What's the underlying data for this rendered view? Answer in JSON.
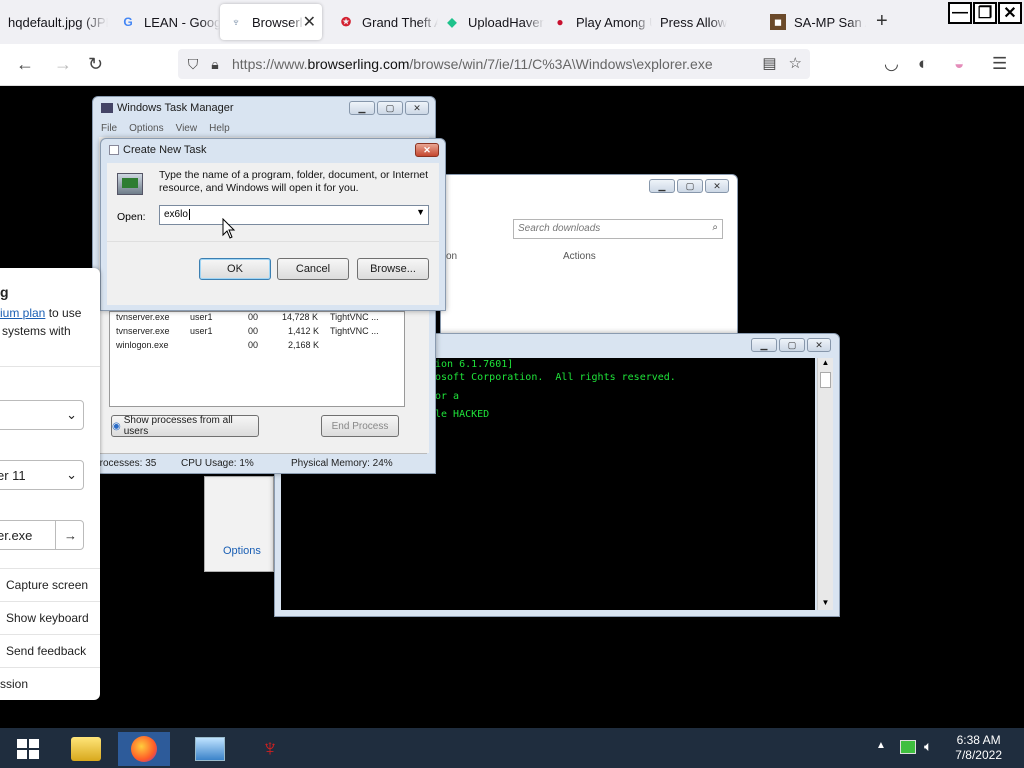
{
  "browser": {
    "tabs": [
      {
        "label": "hqdefault.jpg (JPEG",
        "icon": "image-icon"
      },
      {
        "label": "LEAN - Google",
        "icon": "google-icon"
      },
      {
        "label": "Browserling",
        "icon": "browserling-icon",
        "active": true
      },
      {
        "label": "Grand Theft Auto",
        "icon": "rockstar-icon"
      },
      {
        "label": "UploadHaven",
        "icon": "uploadhaven-icon"
      },
      {
        "label": "Play Among Us",
        "icon": "amongus-icon"
      },
      {
        "label": "Press Allow",
        "icon": ""
      },
      {
        "label": "SA-MP San Andreas",
        "icon": "samp-icon"
      }
    ],
    "url_prefix": "https://www.",
    "url_domain": "browserling.com",
    "url_path": "/browse/win/7/ie/11/C%3A\\Windows\\explorer.exe"
  },
  "side_panel": {
    "heading": "g",
    "promo_link": "ium plan",
    "promo_after": " to use",
    "promo_line2": "systems with",
    "browser_select": "er 11",
    "url_field": "er.exe",
    "menu": [
      "Capture screen",
      "Show keyboard",
      "Send feedback",
      "ssion"
    ]
  },
  "task_manager": {
    "title": "Windows Task Manager",
    "menu": [
      "File",
      "Options",
      "View",
      "Help"
    ],
    "processes": [
      {
        "name": "tvnserver.exe",
        "user": "user1",
        "cpu": "00",
        "mem": "14,728 K",
        "desc": "TightVNC ..."
      },
      {
        "name": "tvnserver.exe",
        "user": "user1",
        "cpu": "00",
        "mem": "1,412 K",
        "desc": "TightVNC ..."
      },
      {
        "name": "winlogon.exe",
        "user": "",
        "cpu": "00",
        "mem": "2,168 K",
        "desc": ""
      }
    ],
    "show_all_button": "Show processes from all users",
    "end_process_button": "End Process",
    "status_processes": "Processes: 35",
    "status_cpu": "CPU Usage: 1%",
    "status_memory": "Physical Memory: 24%"
  },
  "create_task": {
    "title": "Create New Task",
    "description": "Type the name of a program, folder, document, or Internet resource, and Windows will open it for you.",
    "open_label": "Open:",
    "open_value": "ex6lo",
    "ok": "OK",
    "cancel": "Cancel",
    "browse": "Browse..."
  },
  "downloads": {
    "search_placeholder": "Search downloads",
    "col_location": "tion",
    "col_actions": "Actions",
    "options_link": "Options"
  },
  "console": {
    "lines": [
      "ion 6.1.7601]",
      "osoft Corporation.  All rights reserved.",
      "",
      "or a",
      "",
      "le HACKED"
    ]
  },
  "taskbar": {
    "time": "6:38 AM",
    "date": "7/8/2022"
  }
}
